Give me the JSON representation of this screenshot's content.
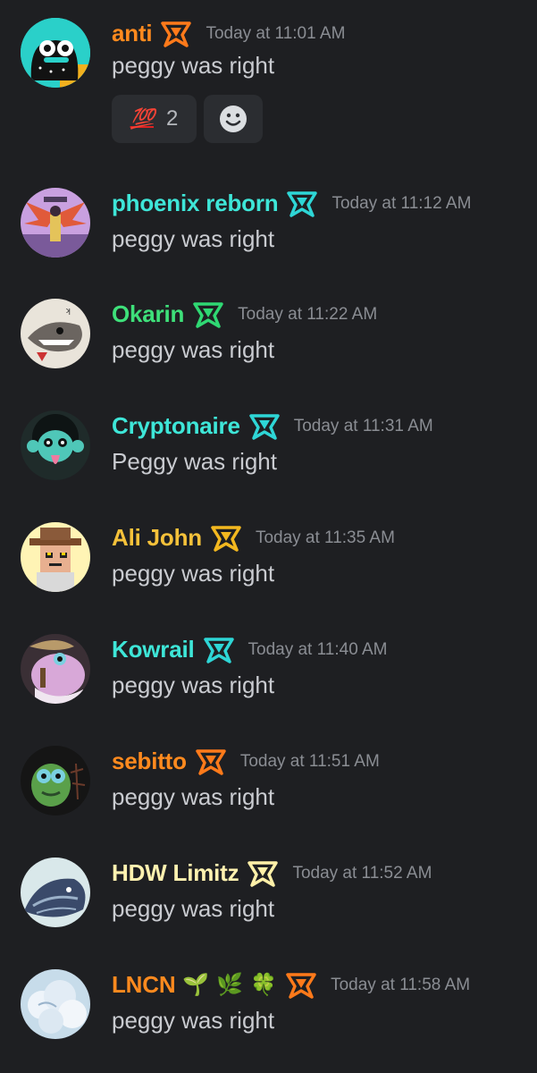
{
  "messages": [
    {
      "username": "anti",
      "name_color": "#ff8a1e",
      "badge_color": "#ff7a1a",
      "timestamp": "Today at 11:01 AM",
      "text": "peggy was right",
      "avatar_icon": "panda-avatar",
      "avatar_bg": "#2ad0c9"
    },
    {
      "username": "phoenix reborn",
      "name_color": "#3ee6d8",
      "badge_color": "#2ed6d6",
      "timestamp": "Today at 11:12 AM",
      "text": "peggy was right",
      "avatar_icon": "phoenix-avatar",
      "avatar_bg": "#c9a0e0"
    },
    {
      "username": "Okarin",
      "name_color": "#3ee07a",
      "badge_color": "#2fd873",
      "timestamp": "Today at 11:22 AM",
      "text": "peggy was right",
      "avatar_icon": "shark-avatar",
      "avatar_bg": "#e9e4da"
    },
    {
      "username": "Cryptonaire",
      "name_color": "#3ee6d8",
      "badge_color": "#2ed6d6",
      "timestamp": "Today at 11:31 AM",
      "text": "Peggy was right",
      "avatar_icon": "monkey-avatar",
      "avatar_bg": "#1f2b2a"
    },
    {
      "username": "Ali John",
      "name_color": "#f5c13a",
      "badge_color": "#f3b81f",
      "timestamp": "Today at 11:35 AM",
      "text": "peggy was right",
      "avatar_icon": "cowboy-avatar",
      "avatar_bg": "#fff4b5"
    },
    {
      "username": "Kowrail",
      "name_color": "#3ee6d8",
      "badge_color": "#2ed6d6",
      "timestamp": "Today at 11:40 AM",
      "text": "peggy was right",
      "avatar_icon": "creature-avatar",
      "avatar_bg": "#3a2f35"
    },
    {
      "username": "sebitto",
      "name_color": "#ff8a1e",
      "badge_color": "#ff7a1a",
      "timestamp": "Today at 11:51 AM",
      "text": "peggy was right",
      "avatar_icon": "frog-avatar",
      "avatar_bg": "#151515"
    },
    {
      "username": "HDW Limitz",
      "name_color": "#fff2b0",
      "badge_color": "#fff0a8",
      "timestamp": "Today at 11:52 AM",
      "text": "peggy was right",
      "avatar_icon": "whale-avatar",
      "avatar_bg": "#d9e8ea"
    },
    {
      "username": "LNCN",
      "name_color": "#ff8a1e",
      "badge_color": "#ff7a1a",
      "timestamp": "Today at 11:58 AM",
      "text": "peggy was right",
      "avatar_icon": "cloud-avatar",
      "avatar_bg": "#c7dcea",
      "emojis": [
        "🌱",
        "🌿",
        "🍀"
      ]
    }
  ],
  "reactions": {
    "emoji": "💯",
    "count": "2",
    "add_icon": "add-reaction-smiley-icon"
  }
}
